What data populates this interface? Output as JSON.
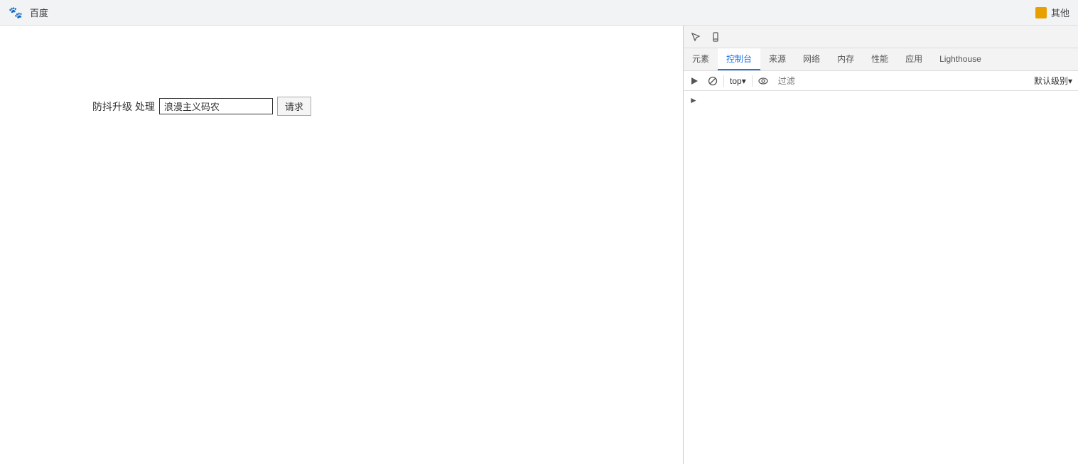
{
  "browser": {
    "topbar": {
      "favicon_symbol": "🐾",
      "title": "百度",
      "other_label": "其他"
    }
  },
  "page": {
    "label_prefix": "防抖升级 处理",
    "input_value": "浪漫主义码农",
    "button_label": "请求"
  },
  "devtools": {
    "tabs": [
      {
        "id": "elements",
        "label": "元素"
      },
      {
        "id": "console",
        "label": "控制台"
      },
      {
        "id": "sources",
        "label": "来源"
      },
      {
        "id": "network",
        "label": "网络"
      },
      {
        "id": "memory",
        "label": "内存"
      },
      {
        "id": "performance",
        "label": "性能"
      },
      {
        "id": "application",
        "label": "应用"
      },
      {
        "id": "lighthouse",
        "label": "Lighthouse"
      }
    ],
    "active_tab": "console",
    "console": {
      "top_label": "top",
      "top_dropdown": "▾",
      "filter_placeholder": "过滤",
      "level_label": "默认级别",
      "level_dropdown": "▾"
    }
  }
}
